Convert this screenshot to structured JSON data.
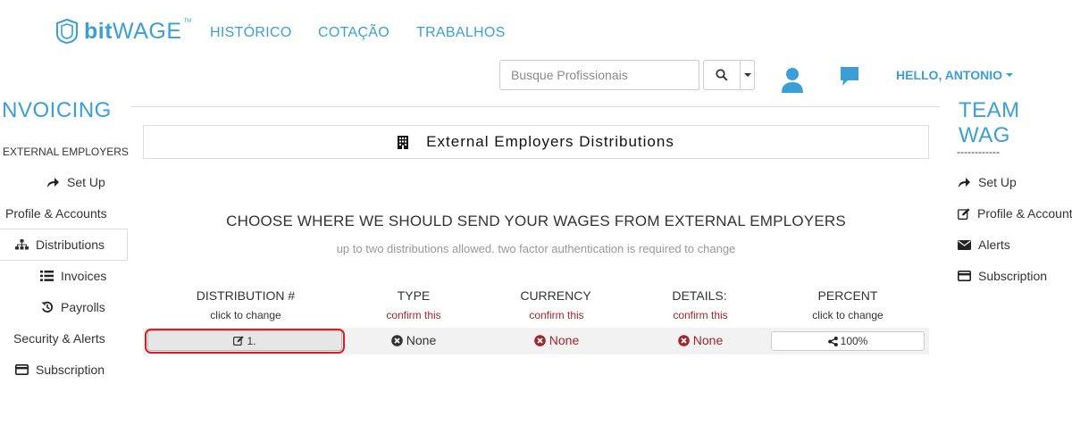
{
  "brand": {
    "name_bold": "bit",
    "name_rest": "WAGE",
    "tm": "TM"
  },
  "nav": [
    {
      "label": "HISTÓRICO"
    },
    {
      "label": "COTAÇÃO"
    },
    {
      "label": "TRABALHOS"
    }
  ],
  "search": {
    "placeholder": "Busque Profissionais",
    "value": ""
  },
  "user": {
    "greeting": "HELLO, ANTONIO"
  },
  "left_sidebar": {
    "heading": "INVOICING",
    "subheading": "EXTERNAL EMPLOYERS",
    "items": [
      {
        "label": "Set Up",
        "icon": "share-icon"
      },
      {
        "label": "Profile & Accounts",
        "icon": "none"
      },
      {
        "label": "Distributions",
        "icon": "sitemap-icon",
        "active": true
      },
      {
        "label": "Invoices",
        "icon": "list-icon"
      },
      {
        "label": "Payrolls",
        "icon": "history-icon"
      },
      {
        "label": "Security & Alerts",
        "icon": "none"
      },
      {
        "label": "Subscription",
        "icon": "credit-card-icon"
      }
    ]
  },
  "right_sidebar": {
    "heading": "TEAM WAG",
    "subheading": "------------",
    "items": [
      {
        "label": "Set Up",
        "icon": "share-icon"
      },
      {
        "label": "Profile & Account",
        "icon": "edit-icon"
      },
      {
        "label": "Alerts",
        "icon": "envelope-icon"
      },
      {
        "label": "Subscription",
        "icon": "credit-card-icon"
      }
    ]
  },
  "main": {
    "title": "External Employers Distributions",
    "headline": "CHOOSE WHERE WE SHOULD SEND YOUR WAGES FROM EXTERNAL EMPLOYERS",
    "subline": "up to two distributions allowed. two factor authentication is required to change",
    "columns": [
      {
        "label": "DISTRIBUTION #",
        "hint": "click to change",
        "hint_style": "dark"
      },
      {
        "label": "TYPE",
        "hint": "confirm this",
        "hint_style": "red"
      },
      {
        "label": "CURRENCY",
        "hint": "confirm this",
        "hint_style": "red"
      },
      {
        "label": "DETAILS:",
        "hint": "confirm this",
        "hint_style": "red"
      },
      {
        "label": "PERCENT",
        "hint": "click to change",
        "hint_style": "dark"
      }
    ],
    "row": {
      "distribution": "1.",
      "type": "None",
      "currency": "None",
      "details": "None",
      "percent": "100%"
    }
  },
  "colors": {
    "accent": "#3a9fd6",
    "danger": "#a0272b",
    "highlight": "#d61f26"
  }
}
